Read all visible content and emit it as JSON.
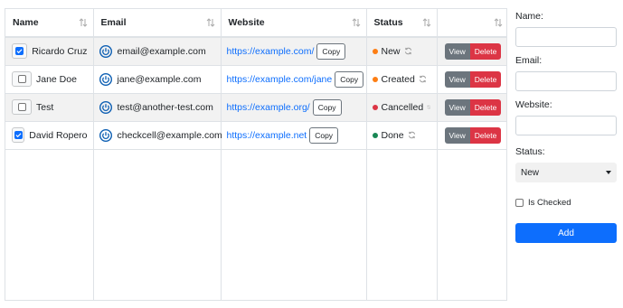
{
  "table": {
    "headers": {
      "name": "Name",
      "email": "Email",
      "website": "Website",
      "status": "Status",
      "actions": ""
    },
    "rows": [
      {
        "checked": true,
        "name": "Ricardo Cruz",
        "email": "email@example.com",
        "website": "https://example.com/",
        "status": "New",
        "status_color": "#fd7e14"
      },
      {
        "checked": false,
        "name": "Jane Doe",
        "email": "jane@example.com",
        "website": "https://example.com/jane",
        "status": "Created",
        "status_color": "#fd7e14"
      },
      {
        "checked": false,
        "name": "Test",
        "email": "test@another-test.com",
        "website": "https://example.org/",
        "status": "Cancelled",
        "status_color": "#dc3545"
      },
      {
        "checked": true,
        "name": "David Ropero",
        "email": "checkcell@example.com",
        "website": "https://example.net",
        "status": "Done",
        "status_color": "#198754"
      }
    ],
    "copy_label": "Copy",
    "view_label": "View",
    "delete_label": "Delete"
  },
  "form": {
    "name_label": "Name:",
    "email_label": "Email:",
    "website_label": "Website:",
    "status_label": "Status:",
    "status_selected": "New",
    "checked_label": "Is Checked",
    "add_label": "Add"
  },
  "colors": {
    "primary": "#0d6efd",
    "danger": "#dc3545",
    "secondary": "#6c757d"
  },
  "icons": [
    "sort-icon",
    "power-icon",
    "refresh-icon",
    "check-icon",
    "chevron-down-icon"
  ]
}
